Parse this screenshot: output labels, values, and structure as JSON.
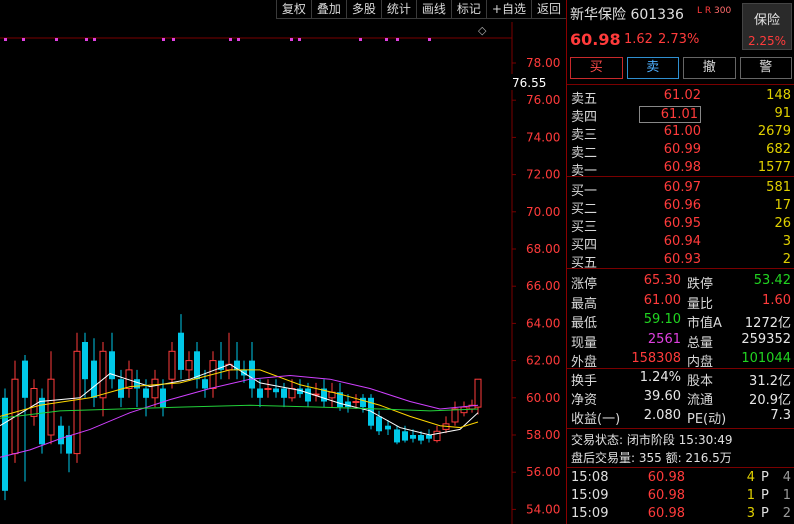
{
  "toolbar": [
    "复权",
    "叠加",
    "多股",
    "统计",
    "画线",
    "标记",
    "+自选",
    "返回"
  ],
  "chart": {
    "ylabels": [
      "78.00",
      "76.00",
      "74.00",
      "72.00",
      "70.00",
      "68.00",
      "66.00",
      "64.00",
      "62.00",
      "60.00",
      "58.00",
      "56.00",
      "54.00"
    ],
    "high_marker": "76.55",
    "diamond": "◇",
    "colors": {
      "up": "#ff3b3b",
      "down": "#00c8e8",
      "ma5": "#ffffff",
      "ma10": "#ffd700",
      "ma20": "#d040ff",
      "ma60": "#22d03a",
      "grid": "#7a0000"
    }
  },
  "stock": {
    "name": "新华保险",
    "code": "601336",
    "lr_tag": "L R",
    "index_tag": "300",
    "price": "60.98",
    "change": "1.62",
    "pct": "2.73%",
    "sector_name": "保险",
    "sector_pct": "2.25%"
  },
  "actions": {
    "buy": "买",
    "sell": "卖",
    "cancel": "撤",
    "alert": "警"
  },
  "asks": [
    {
      "label": "卖五",
      "price": "61.02",
      "vol": "148"
    },
    {
      "label": "卖四",
      "price": "61.01",
      "vol": "91"
    },
    {
      "label": "卖三",
      "price": "61.00",
      "vol": "2679"
    },
    {
      "label": "卖二",
      "price": "60.99",
      "vol": "682"
    },
    {
      "label": "卖一",
      "price": "60.98",
      "vol": "1577"
    }
  ],
  "bids": [
    {
      "label": "买一",
      "price": "60.97",
      "vol": "581"
    },
    {
      "label": "买二",
      "price": "60.96",
      "vol": "17"
    },
    {
      "label": "买三",
      "price": "60.95",
      "vol": "26"
    },
    {
      "label": "买四",
      "price": "60.94",
      "vol": "3"
    },
    {
      "label": "买五",
      "price": "60.93",
      "vol": "2"
    }
  ],
  "stats1": [
    {
      "l1": "涨停",
      "v1": "65.30",
      "c1": "red",
      "l2": "跌停",
      "v2": "53.42",
      "c2": "green"
    },
    {
      "l1": "最高",
      "v1": "61.00",
      "c1": "red",
      "l2": "量比",
      "v2": "1.60",
      "c2": "red"
    },
    {
      "l1": "最低",
      "v1": "59.10",
      "c1": "green",
      "l2": "市值A",
      "v2": "1272亿",
      "c2": "white"
    },
    {
      "l1": "现量",
      "v1": "2561",
      "c1": "magenta",
      "l2": "总量",
      "v2": "259352",
      "c2": "white"
    },
    {
      "l1": "外盘",
      "v1": "158308",
      "c1": "red",
      "l2": "内盘",
      "v2": "101044",
      "c2": "green"
    }
  ],
  "stats2": [
    {
      "l1": "换手",
      "v1": "1.24%",
      "l2": "股本",
      "v2": "31.2亿"
    },
    {
      "l1": "净资",
      "v1": "39.60",
      "l2": "流通",
      "v2": "20.9亿"
    },
    {
      "l1": "收益(一)",
      "v1": "2.080",
      "l2": "PE(动)",
      "v2": "7.3"
    }
  ],
  "status": {
    "line1": "交易状态: 闭市阶段 15:30:49",
    "line2": "盘后交易量: 355  额: 216.5万"
  },
  "ticks": [
    {
      "time": "15:08",
      "price": "60.98",
      "qty": "4",
      "flag": "P",
      "n": "4"
    },
    {
      "time": "15:09",
      "price": "60.98",
      "qty": "1",
      "flag": "P",
      "n": "1"
    },
    {
      "time": "15:09",
      "price": "60.98",
      "qty": "3",
      "flag": "P",
      "n": "2"
    }
  ]
}
